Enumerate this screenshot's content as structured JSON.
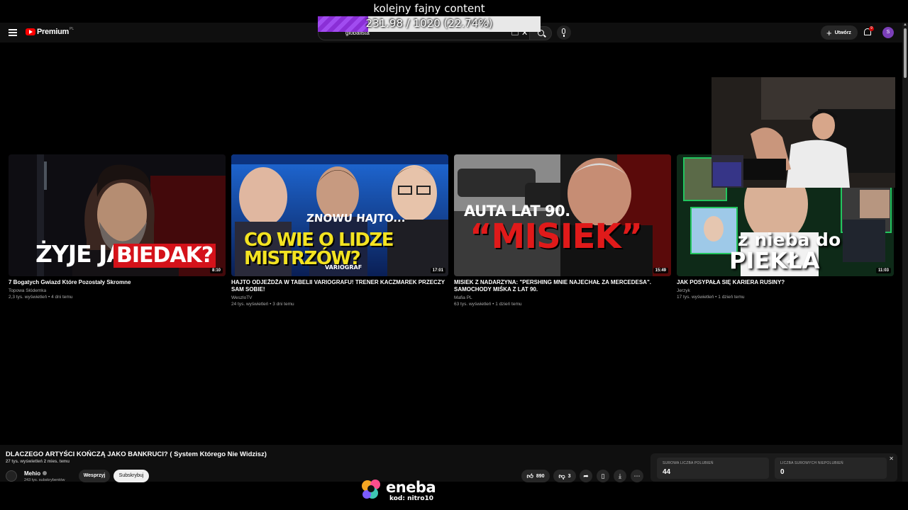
{
  "overlay": {
    "title": "kolejny fajny content",
    "progress_text": "231.98 / 1020 (22.74%)",
    "progress_fraction": 0.2274
  },
  "header": {
    "logo_text": "Premium",
    "logo_region": "PL",
    "search_value": "globalista",
    "create_label": "Utwórz",
    "notification_count": "9",
    "avatar_letter": "S"
  },
  "videos": [
    {
      "title": "7 Bogatych Gwiazd Które Pozostały Skromne",
      "channel": "Topowa Słódemka",
      "meta": "2,3 tys. wyświetleń • 4 dni temu",
      "duration": "8:10",
      "thumb_text_a": "ŻYJE JAK",
      "thumb_text_b": "BIEDAK?"
    },
    {
      "title": "HAJTO ODJEŻDŻA W TABELII VARIOGRAFU! TRENER KACZMAREK PRZECZY SAM SOBIE!",
      "channel": "WeszloTV",
      "meta": "24 tys. wyświetleń • 3 dni temu",
      "duration": "17:01",
      "thumb_text_a": "ZNOWU HAJTO...",
      "thumb_text_b": "CO WIE O LIDZE MISTRZÓW?",
      "thumb_text_c": "VARIOGRAF"
    },
    {
      "title": "MISIEK Z NADARZYNA: \"PERSHING MNIE NAJECHAŁ ZA MERCEDESA\". SAMOCHODY MIŚKA Z LAT 90.",
      "channel": "Mafia PL",
      "meta": "63 tys. wyświetleń • 1 dzień temu",
      "duration": "15:49",
      "thumb_text_a": "AUTA LAT 90.",
      "thumb_text_b": "“MISIEK”"
    },
    {
      "title": "JAK POSYPAŁA SIĘ KARIERA RUSINY?",
      "channel": "Jerzyk",
      "meta": "17 tys. wyświetleń • 1 dzień temu",
      "duration": "11:03",
      "thumb_text_a": "z nieba do",
      "thumb_text_b": "PIEKŁA"
    }
  ],
  "now_playing": {
    "title": "DLACZEGO ARTYŚCI KOŃCZĄ JAKO BANKRUCI? ( System Którego Nie Widzisz)",
    "meta": "27 tys. wyświetleń  2 mies. temu",
    "channel": "Mehio",
    "subscribers": "243 tys. subskrybentów",
    "support_label": "Wesprzyj",
    "subscribe_label": "Subskrybuj",
    "likes": "890",
    "dislikes": "3"
  },
  "stats": {
    "likes_label": "SUROWA LICZBA POLUBIEŃ",
    "likes_value": "44",
    "dislikes_label": "LICZBA SUROWYCH NIEPOLUBIEŃ",
    "dislikes_value": "0"
  },
  "sponsor": {
    "name": "eneba",
    "code": "kod: nitro10"
  },
  "colors": {
    "progress_fill": "#8a2fd6",
    "yt_red": "#ff0000",
    "avatar": "#7b3fb8"
  }
}
